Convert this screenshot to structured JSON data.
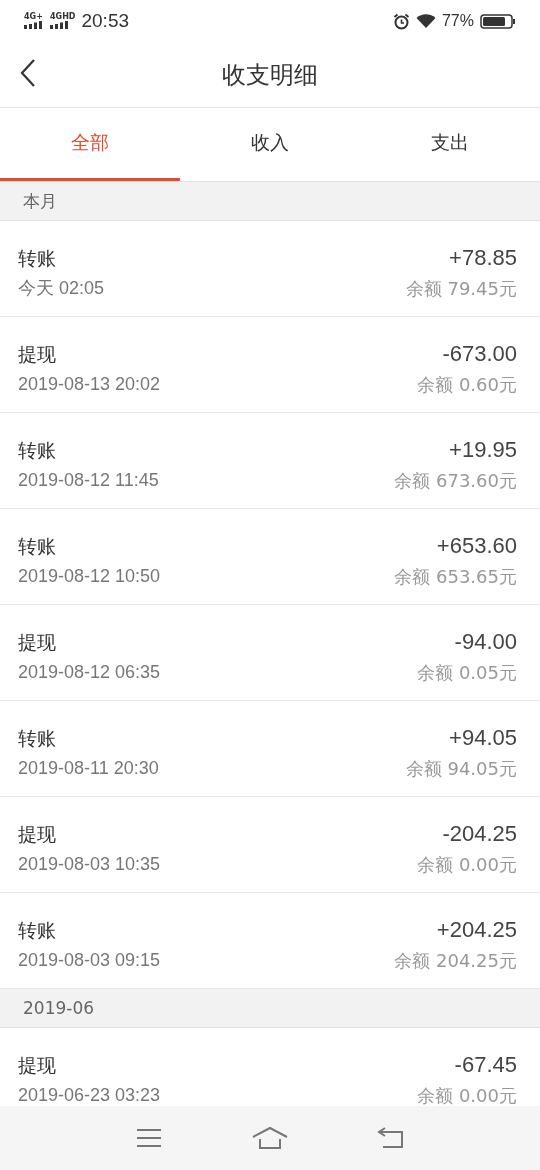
{
  "status_bar": {
    "network_1": "4G+",
    "network_2": "4GHD",
    "time": "20:53",
    "battery": "77%"
  },
  "nav": {
    "title": "收支明细"
  },
  "tabs": [
    {
      "label": "全部",
      "selected": true
    },
    {
      "label": "收入",
      "selected": false
    },
    {
      "label": "支出",
      "selected": false
    }
  ],
  "sections": [
    {
      "title": "本月",
      "rows": [
        {
          "type": "转账",
          "time": "今天 02:05",
          "amount": "+78.85",
          "balance": "余额 79.45元"
        },
        {
          "type": "提现",
          "time": "2019-08-13 20:02",
          "amount": "-673.00",
          "balance": "余额 0.60元"
        },
        {
          "type": "转账",
          "time": "2019-08-12 11:45",
          "amount": "+19.95",
          "balance": "余额 673.60元"
        },
        {
          "type": "转账",
          "time": "2019-08-12 10:50",
          "amount": "+653.60",
          "balance": "余额 653.65元"
        },
        {
          "type": "提现",
          "time": "2019-08-12 06:35",
          "amount": "-94.00",
          "balance": "余额 0.05元"
        },
        {
          "type": "转账",
          "time": "2019-08-11 20:30",
          "amount": "+94.05",
          "balance": "余额 94.05元"
        },
        {
          "type": "提现",
          "time": "2019-08-03 10:35",
          "amount": "-204.25",
          "balance": "余额 0.00元"
        },
        {
          "type": "转账",
          "time": "2019-08-03 09:15",
          "amount": "+204.25",
          "balance": "余额 204.25元"
        }
      ]
    },
    {
      "title": "2019-06",
      "rows": [
        {
          "type": "提现",
          "time": "2019-06-23 03:23",
          "amount": "-67.45",
          "balance": "余额 0.00元"
        }
      ]
    }
  ]
}
